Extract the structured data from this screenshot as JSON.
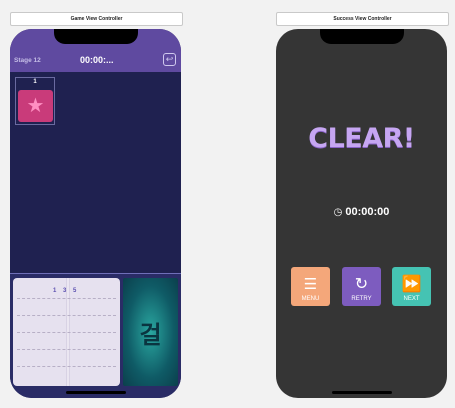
{
  "scenes": {
    "game_title": "Game View Controller",
    "success_title": "Success View Controller"
  },
  "game": {
    "stage_label": "Stage 12",
    "timer": "00:00:...",
    "undo_icon": "undo-icon",
    "slot_number": "1",
    "star_glyph": "★",
    "book_numbers": [
      "1",
      "3",
      "5"
    ],
    "hangul_glyph": "걸"
  },
  "success": {
    "clear_text": "CLEAR!",
    "clock_icon": "clock-icon",
    "elapsed": "00:00:00",
    "buttons": {
      "menu": "MENU",
      "retry": "RETRY",
      "next": "NEXT"
    }
  },
  "colors": {
    "game_bg": "#1f2150",
    "hud": "#5f4aa0",
    "success_bg": "#353535",
    "menu": "#f4a77a",
    "retry": "#7d5cbf",
    "next": "#45c3b3"
  }
}
